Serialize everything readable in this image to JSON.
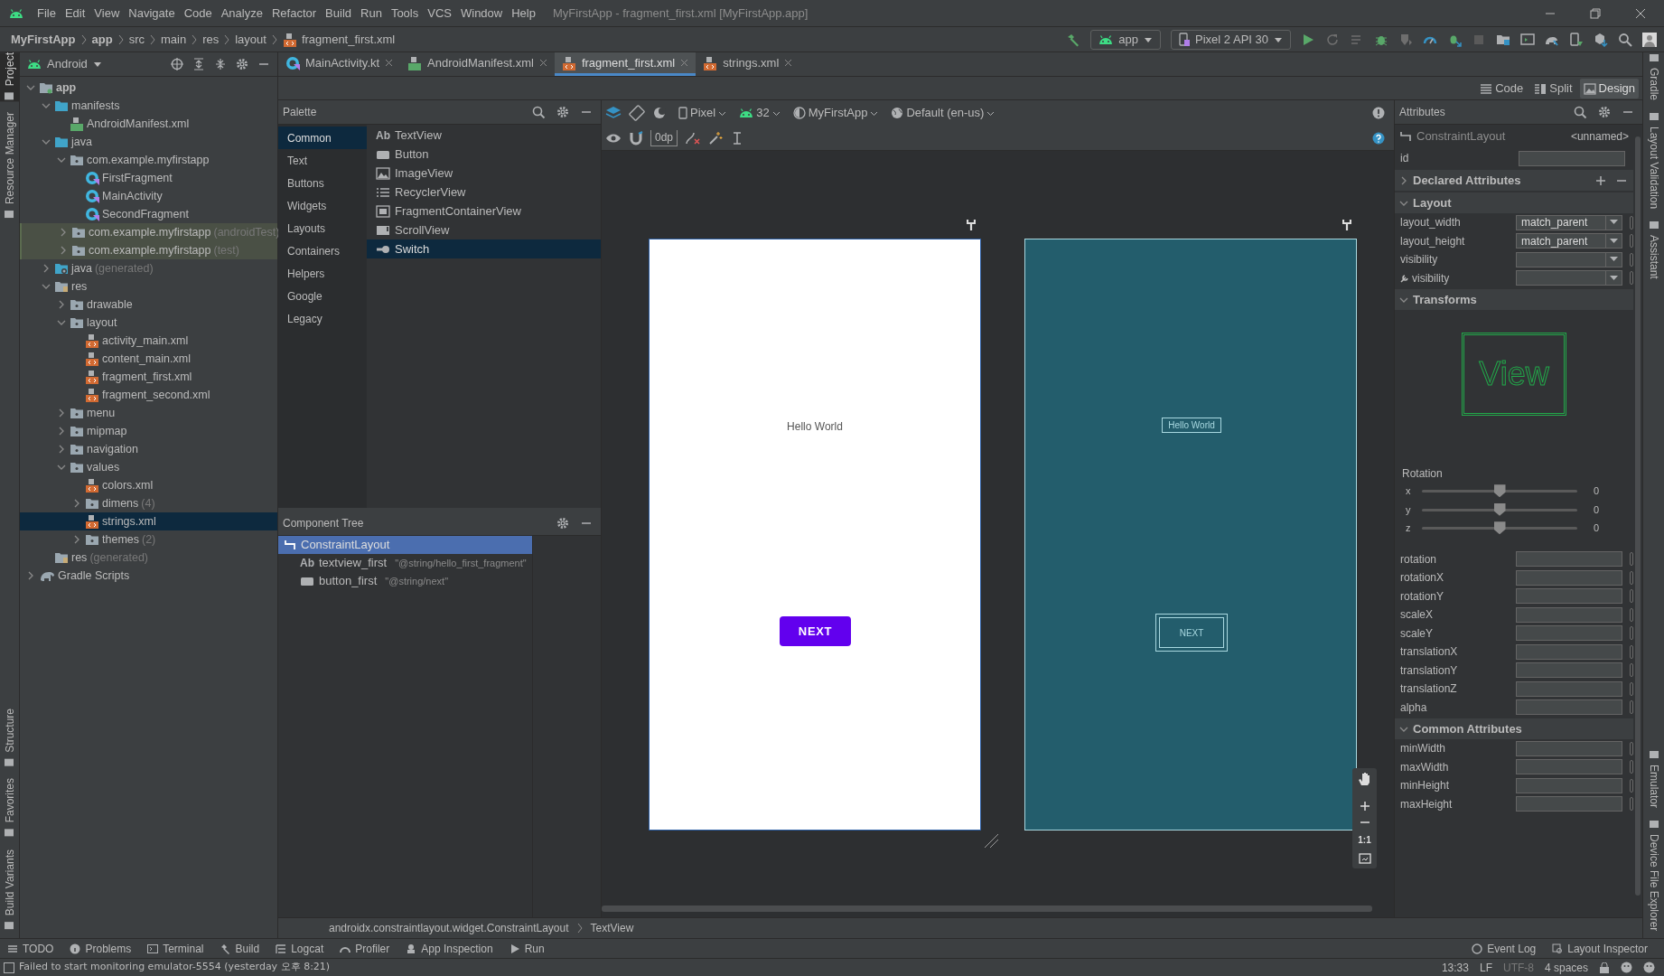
{
  "menu_bar": [
    "File",
    "Edit",
    "View",
    "Navigate",
    "Code",
    "Analyze",
    "Refactor",
    "Build",
    "Run",
    "Tools",
    "VCS",
    "Window",
    "Help"
  ],
  "window_title": "MyFirstApp - fragment_first.xml [MyFirstApp.app]",
  "breadcrumb": [
    "MyFirstApp",
    "app",
    "src",
    "main",
    "res",
    "layout",
    "fragment_first.xml"
  ],
  "run_config": {
    "module": "app",
    "device": "Pixel 2 API 30"
  },
  "left_stripe": {
    "top": [
      {
        "label": "Project",
        "selected": true
      },
      {
        "label": "Resource Manager",
        "selected": false
      }
    ],
    "bottom": [
      {
        "label": "Structure",
        "selected": false
      },
      {
        "label": "Favorites",
        "selected": false
      },
      {
        "label": "Build Variants",
        "selected": false
      }
    ]
  },
  "right_stripe": {
    "top": [
      {
        "label": "Gradle",
        "selected": false
      },
      {
        "label": "Layout Validation",
        "selected": false
      },
      {
        "label": "Assistant",
        "selected": false
      }
    ],
    "bottom": [
      {
        "label": "Emulator",
        "selected": false
      },
      {
        "label": "Device File Explorer",
        "selected": false
      }
    ]
  },
  "project_panel": {
    "view": "Android",
    "tree": [
      {
        "label": "app",
        "kind": "module",
        "expanded": true,
        "selected": false,
        "highlighted": false,
        "children": [
          {
            "label": "manifests",
            "kind": "source_folder",
            "expanded": true,
            "selected": false,
            "highlighted": false,
            "children": [
              {
                "label": "AndroidManifest.xml",
                "kind": "manifest",
                "selected": false,
                "highlighted": false
              }
            ]
          },
          {
            "label": "java",
            "kind": "source_folder",
            "expanded": true,
            "selected": false,
            "highlighted": false,
            "children": [
              {
                "label": "com.example.myfirstapp",
                "kind": "package",
                "expanded": true,
                "selected": false,
                "highlighted": false,
                "children": [
                  {
                    "label": "FirstFragment",
                    "kind": "kotlin",
                    "selected": false,
                    "highlighted": false
                  },
                  {
                    "label": "MainActivity",
                    "kind": "kotlin",
                    "selected": false,
                    "highlighted": false
                  },
                  {
                    "label": "SecondFragment",
                    "kind": "kotlin",
                    "selected": false,
                    "highlighted": false
                  }
                ]
              },
              {
                "label": "com.example.myfirstapp",
                "note": "(androidTest)",
                "kind": "package",
                "expanded": false,
                "selected": false,
                "highlighted": true
              },
              {
                "label": "com.example.myfirstapp",
                "note": "(test)",
                "kind": "package",
                "expanded": false,
                "selected": false,
                "highlighted": true
              }
            ]
          },
          {
            "label": "java",
            "note": "(generated)",
            "kind": "generated",
            "expanded": false,
            "selected": false,
            "highlighted": false
          },
          {
            "label": "res",
            "kind": "res",
            "expanded": true,
            "selected": false,
            "highlighted": false,
            "children": [
              {
                "label": "drawable",
                "kind": "package",
                "expanded": false,
                "selected": false,
                "highlighted": false
              },
              {
                "label": "layout",
                "kind": "package",
                "expanded": true,
                "selected": false,
                "highlighted": false,
                "children": [
                  {
                    "label": "activity_main.xml",
                    "kind": "xml",
                    "selected": false,
                    "highlighted": false
                  },
                  {
                    "label": "content_main.xml",
                    "kind": "xml",
                    "selected": false,
                    "highlighted": false
                  },
                  {
                    "label": "fragment_first.xml",
                    "kind": "xml",
                    "selected": false,
                    "highlighted": false
                  },
                  {
                    "label": "fragment_second.xml",
                    "kind": "xml",
                    "selected": false,
                    "highlighted": false
                  }
                ]
              },
              {
                "label": "menu",
                "kind": "package",
                "expanded": false,
                "selected": false,
                "highlighted": false
              },
              {
                "label": "mipmap",
                "kind": "package",
                "expanded": false,
                "selected": false,
                "highlighted": false
              },
              {
                "label": "navigation",
                "kind": "package",
                "expanded": false,
                "selected": false,
                "highlighted": false
              },
              {
                "label": "values",
                "kind": "package",
                "expanded": true,
                "selected": false,
                "highlighted": false,
                "children": [
                  {
                    "label": "colors.xml",
                    "kind": "xml",
                    "selected": false,
                    "highlighted": false
                  },
                  {
                    "label": "dimens",
                    "note": "(4)",
                    "kind": "package",
                    "expanded": false,
                    "selected": false,
                    "highlighted": false
                  },
                  {
                    "label": "strings.xml",
                    "kind": "xml",
                    "selected": true,
                    "highlighted": false
                  },
                  {
                    "label": "themes",
                    "note": "(2)",
                    "kind": "package",
                    "expanded": false,
                    "selected": false,
                    "highlighted": false
                  }
                ]
              }
            ]
          },
          {
            "label": "res",
            "note": "(generated)",
            "kind": "res",
            "selected": false,
            "highlighted": false
          }
        ]
      },
      {
        "label": "Gradle Scripts",
        "kind": "gradle",
        "expanded": false,
        "selected": false,
        "highlighted": false
      }
    ]
  },
  "editor_tabs": [
    {
      "label": "MainActivity.kt",
      "kind": "kotlin",
      "selected": false
    },
    {
      "label": "AndroidManifest.xml",
      "kind": "manifest",
      "selected": false
    },
    {
      "label": "fragment_first.xml",
      "kind": "xml",
      "selected": true
    },
    {
      "label": "strings.xml",
      "kind": "xml",
      "selected": false
    }
  ],
  "view_modes": [
    {
      "label": "Code",
      "selected": false
    },
    {
      "label": "Split",
      "selected": false
    },
    {
      "label": "Design",
      "selected": true
    }
  ],
  "palette": {
    "title": "Palette",
    "categories": [
      {
        "label": "Common",
        "selected": true
      },
      {
        "label": "Text",
        "selected": false
      },
      {
        "label": "Buttons",
        "selected": false
      },
      {
        "label": "Widgets",
        "selected": false
      },
      {
        "label": "Layouts",
        "selected": false
      },
      {
        "label": "Containers",
        "selected": false
      },
      {
        "label": "Helpers",
        "selected": false
      },
      {
        "label": "Google",
        "selected": false
      },
      {
        "label": "Legacy",
        "selected": false
      }
    ],
    "items": [
      {
        "label": "TextView",
        "kind": "text",
        "glyph": "Ab",
        "selected": false
      },
      {
        "label": "Button",
        "kind": "button",
        "selected": false
      },
      {
        "label": "ImageView",
        "kind": "image",
        "selected": false
      },
      {
        "label": "RecyclerView",
        "kind": "list",
        "selected": false
      },
      {
        "label": "FragmentContainerView",
        "kind": "container",
        "selected": false
      },
      {
        "label": "ScrollView",
        "kind": "scroll",
        "selected": false
      },
      {
        "label": "Switch",
        "kind": "switch",
        "selected": true
      }
    ]
  },
  "design_toolbar": {
    "device": "Pixel",
    "api": "32",
    "theme": "MyFirstApp",
    "locale": "Default (en-us)",
    "margin": "0dp"
  },
  "design_preview": {
    "text": "Hello World",
    "button": "NEXT"
  },
  "blueprint": {
    "text": "Hello World",
    "button": "NEXT"
  },
  "zoom_controls": {
    "actual_size": "1:1"
  },
  "component_tree": {
    "title": "Component Tree",
    "items": [
      {
        "label": "ConstraintLayout",
        "kind": "layout",
        "selected": true,
        "children": [
          {
            "label": "textview_first",
            "value": "\"@string/hello_first_fragment\"",
            "kind": "text",
            "glyph": "Ab",
            "selected": false
          },
          {
            "label": "button_first",
            "value": "\"@string/next\"",
            "kind": "button",
            "selected": false
          }
        ]
      }
    ]
  },
  "attributes": {
    "title": "Attributes",
    "component": "ConstraintLayout",
    "name": "<unnamed>",
    "id_label": "id",
    "sections": [
      {
        "title": "Declared Attributes",
        "expanded": false
      },
      {
        "title": "Layout",
        "expanded": true,
        "rows": [
          {
            "label": "layout_width",
            "kind": "dropdown",
            "value": "match_parent"
          },
          {
            "label": "layout_height",
            "kind": "dropdown",
            "value": "match_parent"
          },
          {
            "label": "visibility",
            "kind": "dropdown"
          },
          {
            "label": "visibility",
            "kind": "tool_dropdown"
          }
        ]
      },
      {
        "title": "Transforms",
        "expanded": true,
        "preview_label": "View",
        "rotation": {
          "label": "Rotation",
          "axes": [
            {
              "axis": "x",
              "level": 0.5,
              "reading": "0"
            },
            {
              "axis": "y",
              "level": 0.5,
              "reading": "0"
            },
            {
              "axis": "z",
              "level": 0.5,
              "reading": "0"
            }
          ]
        },
        "rows": [
          {
            "label": "rotation",
            "kind": "text"
          },
          {
            "label": "rotationX",
            "kind": "text"
          },
          {
            "label": "rotationY",
            "kind": "text"
          },
          {
            "label": "scaleX",
            "kind": "text"
          },
          {
            "label": "scaleY",
            "kind": "text"
          },
          {
            "label": "translationX",
            "kind": "text"
          },
          {
            "label": "translationY",
            "kind": "text"
          },
          {
            "label": "translationZ",
            "kind": "text"
          },
          {
            "label": "alpha",
            "kind": "text"
          }
        ]
      },
      {
        "title": "Common Attributes",
        "expanded": true,
        "rows": [
          {
            "label": "minWidth",
            "kind": "text"
          },
          {
            "label": "maxWidth",
            "kind": "text"
          },
          {
            "label": "minHeight",
            "kind": "text"
          },
          {
            "label": "maxHeight",
            "kind": "text"
          }
        ]
      }
    ]
  },
  "path_bar": [
    "androidx.constraintlayout.widget.ConstraintLayout",
    "TextView"
  ],
  "tool_windows": {
    "left": [
      "TODO",
      "Problems",
      "Terminal",
      "Build",
      "Logcat",
      "Profiler",
      "App Inspection",
      "Run"
    ],
    "right": [
      "Event Log",
      "Layout Inspector"
    ]
  },
  "status_bar": {
    "message": "Failed to start monitoring emulator-5554 (yesterday 오후 8:21)",
    "position": "13:33",
    "line_separator": "LF",
    "encoding": "UTF-8",
    "indent": "4 spaces"
  }
}
